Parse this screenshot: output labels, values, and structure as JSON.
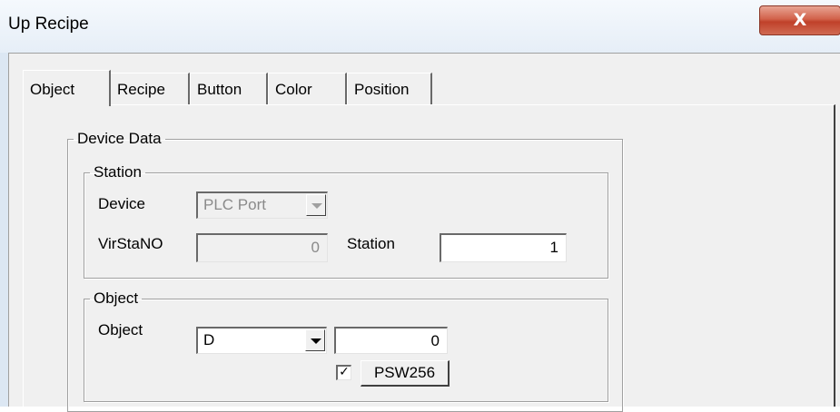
{
  "window": {
    "title": "Up Recipe",
    "close_glyph": "X"
  },
  "tabs": [
    "Object",
    "Recipe",
    "Button",
    "Color",
    "Position"
  ],
  "device_data": {
    "legend": "Device Data",
    "station_group": {
      "legend": "Station",
      "device_label": "Device",
      "device_value": "PLC Port",
      "virstano_label": "VirStaNO",
      "virstano_value": "0",
      "station_label": "Station",
      "station_value": "1"
    },
    "object_group": {
      "legend": "Object",
      "object_label": "Object",
      "object_type_value": "D",
      "object_address_value": "0",
      "checkbox_checked": true,
      "check_glyph": "✓",
      "psw_button_label": "PSW256"
    }
  }
}
